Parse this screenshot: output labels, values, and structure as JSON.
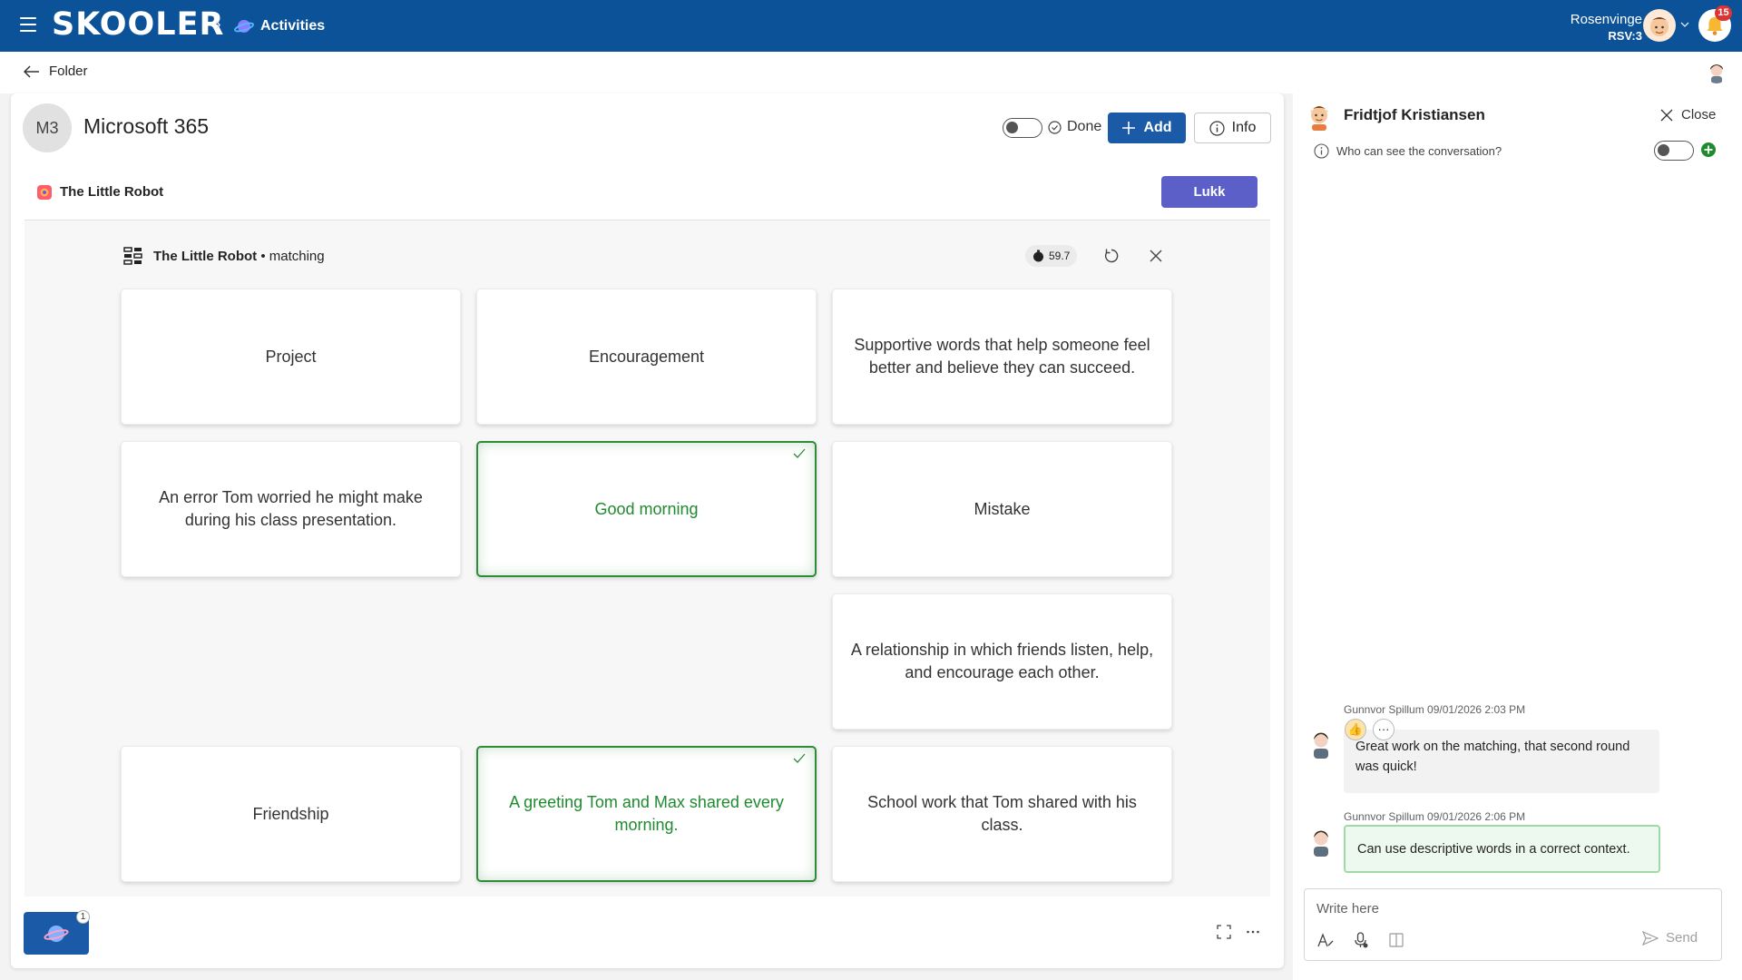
{
  "topbar": {
    "logo": "SKOOLER",
    "breadcrumb_label": "Activities",
    "user_name": "Rosenvinge",
    "user_class": "RSV:3",
    "notification_count": "15"
  },
  "subheader": {
    "back_label": "Folder"
  },
  "header": {
    "initials": "M3",
    "title": "Microsoft 365",
    "done_label": "Done",
    "add_label": "Add",
    "info_label": "Info"
  },
  "activity": {
    "title": "The Little Robot",
    "close_label": "Lukk"
  },
  "game": {
    "title_bold": "The Little Robot",
    "title_suffix": " • matching",
    "timer": "59.7",
    "cards": [
      {
        "text": "Project",
        "matched": false
      },
      {
        "text": "Encouragement",
        "matched": false
      },
      {
        "text": "Supportive words that help someone feel better and believe they can succeed.",
        "matched": false
      },
      {
        "text": "An error Tom worried he might make during his class presentation.",
        "matched": false
      },
      {
        "text": "Good morning",
        "matched": true
      },
      {
        "text": "Mistake",
        "matched": false
      },
      {
        "text": "A relationship in which friends listen, help, and encourage each other.",
        "matched": false
      },
      {
        "text": "Friendship",
        "matched": false
      },
      {
        "text": "A greeting Tom and Max shared every morning.",
        "matched": true
      },
      {
        "text": "School work that Tom shared with his class.",
        "matched": false
      }
    ]
  },
  "bottom": {
    "thumb_badge": "1"
  },
  "chat": {
    "contact_name": "Fridtjof Kristiansen",
    "close_label": "Close",
    "visibility_question": "Who can see the conversation?",
    "messages": [
      {
        "meta": "Gunnvor Spillum 09/01/2026 2:03 PM",
        "text": "Great work on the matching, that second round was quick!",
        "reaction": "👍"
      },
      {
        "meta": "Gunnvor Spillum 09/01/2026 2:06 PM",
        "text": "Can use descriptive words in a correct context."
      }
    ],
    "compose_placeholder": "Write here",
    "send_label": "Send"
  },
  "colors": {
    "topbar": "#0b5299",
    "primary_button": "#1a5aa6",
    "lukk_button": "#5b5fc7",
    "matched_green": "#2e8b3a"
  }
}
